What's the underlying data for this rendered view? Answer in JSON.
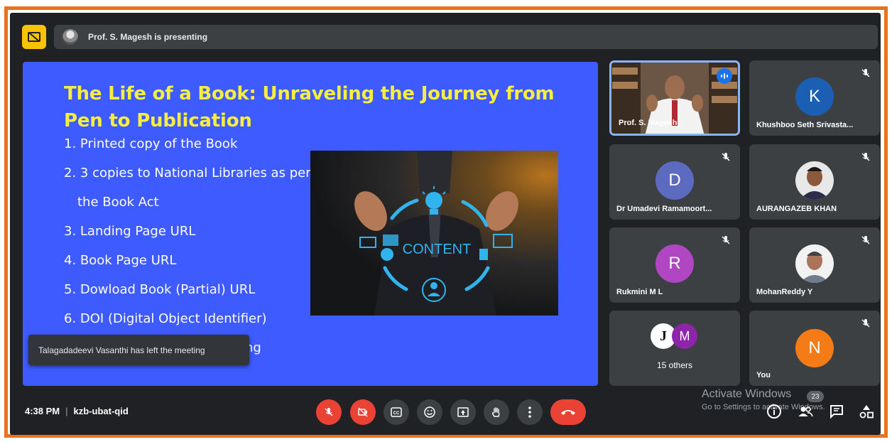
{
  "presenting_bar": {
    "text": "Prof. S. Magesh is presenting"
  },
  "slide": {
    "title": "The Life of a Book: Unraveling the Journey from Pen to Publication",
    "items": [
      "1. Printed copy of the Book",
      "2. 3 copies to National Libraries as per",
      "the Book Act",
      "3. Landing Page URL",
      "4. Book Page URL",
      "5. Dowload Book (Partial) URL",
      "6. DOI (Digital Object Identifier)",
      "ing"
    ],
    "image_text": "CONTENT"
  },
  "toast": {
    "text": "Talagadadeevi Vasanthi has left the meeting"
  },
  "participants": [
    {
      "name": "Prof. S. Magesh",
      "type": "video"
    },
    {
      "name": "Khushboo Seth Srivasta...",
      "initial": "K",
      "color": "#1a5fb4"
    },
    {
      "name": "Dr Umadevi Ramamoort...",
      "initial": "D",
      "color": "#5c6bc0"
    },
    {
      "name": "AURANGAZEB KHAN",
      "type": "photo"
    },
    {
      "name": "Rukmini M L",
      "initial": "R",
      "color": "#b146c2"
    },
    {
      "name": "MohanReddy Y",
      "type": "photo"
    },
    {
      "name": "15 others",
      "initial": "M",
      "color": "#8e24aa"
    },
    {
      "name": "You",
      "initial": "N",
      "color": "#f47b16"
    }
  ],
  "meeting": {
    "time": "4:38 PM",
    "code": "kzb-ubat-qid"
  },
  "watermark": {
    "line1": "Activate Windows",
    "line2": "Go to Settings to activate Windows."
  },
  "participant_count": "23"
}
